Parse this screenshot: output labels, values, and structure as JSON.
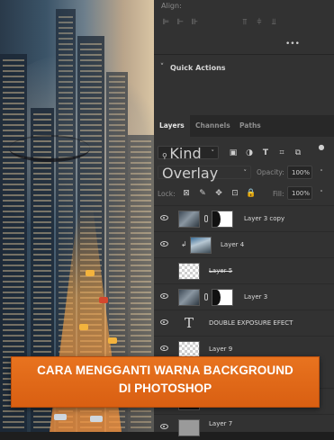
{
  "align": {
    "title": "Align:"
  },
  "quick_actions": {
    "title": "Quick Actions"
  },
  "tabs": [
    {
      "label": "Layers"
    },
    {
      "label": "Channels"
    },
    {
      "label": "Paths"
    }
  ],
  "filter": {
    "kind_label": "Kind"
  },
  "blend": {
    "mode": "Overlay",
    "opacity_label": "Opacity:",
    "opacity_value": "100%"
  },
  "lock": {
    "label": "Lock:",
    "fill_label": "Fill:",
    "fill_value": "100%"
  },
  "layers": [
    {
      "name": "Layer 3 copy"
    },
    {
      "name": "Layer 4"
    },
    {
      "name": "Layer 5"
    },
    {
      "name": "Layer 3"
    },
    {
      "name": "DOUBLE EXPOSURE EFECT"
    },
    {
      "name": "Layer 9"
    },
    {
      "name": "Layer 7"
    }
  ],
  "banner": {
    "line1": "CARA MENGGANTI WARNA BACKGROUND",
    "line2": "DI PHOTOSHOP"
  },
  "colors": {
    "panel": "#323232",
    "banner": "#e06a18"
  }
}
